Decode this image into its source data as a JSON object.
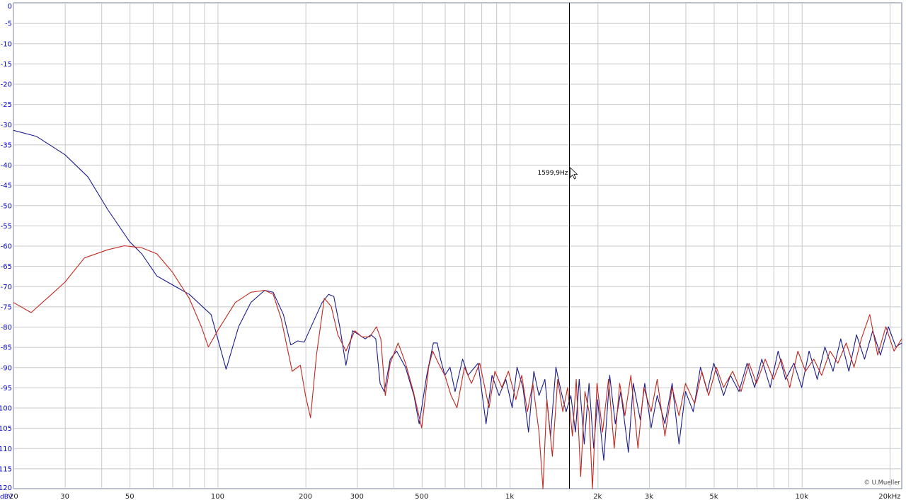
{
  "colors": {
    "background": "#ffffff",
    "grid": "#c8c8c8",
    "frame": "#6a7ea0",
    "ytick_text": "#0000cc",
    "series_blue": "#1c1c8c",
    "series_red": "#c0281e",
    "cursor": "#000000"
  },
  "cursor": {
    "label": "1599,9Hz",
    "freq_hz": 1599.9
  },
  "copyright": "© U.Mueller",
  "y_unit_label": "dBV",
  "chart_data": {
    "type": "line",
    "x_scale": "log",
    "xlim": [
      20,
      22000
    ],
    "ylim": [
      -120,
      0
    ],
    "grid": true,
    "ytick_values": [
      0,
      -5,
      -10,
      -15,
      -20,
      -25,
      -30,
      -35,
      -40,
      -45,
      -50,
      -55,
      -60,
      -65,
      -70,
      -75,
      -80,
      -85,
      -90,
      -95,
      -100,
      -105,
      -110,
      -115,
      -120
    ],
    "ytick_labels": [
      "0",
      "-5",
      "-10",
      "-15",
      "-20",
      "-25",
      "-30",
      "-35",
      "-40",
      "-45",
      "-50",
      "-55",
      "-60",
      "-65",
      "-70",
      "-75",
      "-80",
      "-85",
      "-90",
      "-95",
      "-100",
      "-105",
      "-110",
      "-115",
      "-120"
    ],
    "xtick_labels": [
      {
        "value": 20,
        "label": "20"
      },
      {
        "value": 30,
        "label": "30"
      },
      {
        "value": 50,
        "label": "50"
      },
      {
        "value": 100,
        "label": "100"
      },
      {
        "value": 200,
        "label": "200"
      },
      {
        "value": 300,
        "label": "300"
      },
      {
        "value": 500,
        "label": "500"
      },
      {
        "value": 1000,
        "label": "1k"
      },
      {
        "value": 2000,
        "label": "2k"
      },
      {
        "value": 3000,
        "label": "3k"
      },
      {
        "value": 5000,
        "label": "5k"
      },
      {
        "value": 10000,
        "label": "10k"
      },
      {
        "value": 20000,
        "label": "20kHz"
      }
    ],
    "series": [
      {
        "color": "#1c1c8c",
        "points": [
          [
            20,
            -31.5
          ],
          [
            24,
            -33
          ],
          [
            30,
            -37.5
          ],
          [
            36,
            -43
          ],
          [
            42,
            -51
          ],
          [
            50,
            -59
          ],
          [
            55,
            -62
          ],
          [
            62,
            -67.5
          ],
          [
            80,
            -72
          ],
          [
            95,
            -77
          ],
          [
            107,
            -90.5
          ],
          [
            118,
            -80
          ],
          [
            130,
            -74
          ],
          [
            145,
            -71
          ],
          [
            155,
            -71.5
          ],
          [
            168,
            -77
          ],
          [
            178,
            -84.5
          ],
          [
            188,
            -83.5
          ],
          [
            198,
            -83.8
          ],
          [
            212,
            -79
          ],
          [
            228,
            -74
          ],
          [
            240,
            -72
          ],
          [
            250,
            -72.5
          ],
          [
            262,
            -80
          ],
          [
            275,
            -89.5
          ],
          [
            290,
            -81
          ],
          [
            305,
            -82
          ],
          [
            320,
            -83
          ],
          [
            335,
            -82
          ],
          [
            348,
            -83
          ],
          [
            360,
            -94
          ],
          [
            372,
            -96
          ],
          [
            390,
            -88
          ],
          [
            410,
            -86
          ],
          [
            440,
            -90
          ],
          [
            470,
            -97
          ],
          [
            490,
            -104
          ],
          [
            520,
            -92
          ],
          [
            548,
            -84
          ],
          [
            565,
            -84
          ],
          [
            580,
            -88
          ],
          [
            600,
            -92
          ],
          [
            625,
            -90
          ],
          [
            650,
            -96
          ],
          [
            690,
            -88
          ],
          [
            720,
            -92
          ],
          [
            780,
            -89
          ],
          [
            830,
            -104
          ],
          [
            870,
            -92
          ],
          [
            920,
            -97
          ],
          [
            970,
            -93
          ],
          [
            1020,
            -100
          ],
          [
            1060,
            -90
          ],
          [
            1110,
            -95
          ],
          [
            1160,
            -106
          ],
          [
            1210,
            -91
          ],
          [
            1260,
            -97
          ],
          [
            1320,
            -93
          ],
          [
            1380,
            -107
          ],
          [
            1440,
            -90
          ],
          [
            1500,
            -96
          ],
          [
            1560,
            -101
          ],
          [
            1620,
            -97
          ],
          [
            1680,
            -106
          ],
          [
            1730,
            -93
          ],
          [
            1800,
            -109
          ],
          [
            1870,
            -94
          ],
          [
            1940,
            -110
          ],
          [
            2000,
            -98
          ],
          [
            2100,
            -113
          ],
          [
            2200,
            -92
          ],
          [
            2300,
            -104
          ],
          [
            2400,
            -96
          ],
          [
            2550,
            -111
          ],
          [
            2650,
            -94
          ],
          [
            2800,
            -103
          ],
          [
            2900,
            -94
          ],
          [
            3050,
            -105
          ],
          [
            3200,
            -97
          ],
          [
            3400,
            -104
          ],
          [
            3600,
            -94
          ],
          [
            3800,
            -109
          ],
          [
            4000,
            -96
          ],
          [
            4250,
            -101
          ],
          [
            4500,
            -90
          ],
          [
            4750,
            -96
          ],
          [
            5000,
            -89
          ],
          [
            5400,
            -97
          ],
          [
            5700,
            -92
          ],
          [
            6100,
            -96
          ],
          [
            6500,
            -89
          ],
          [
            6900,
            -95
          ],
          [
            7300,
            -88
          ],
          [
            7800,
            -95
          ],
          [
            8300,
            -86
          ],
          [
            8800,
            -93
          ],
          [
            9400,
            -89
          ],
          [
            10000,
            -95
          ],
          [
            10600,
            -86
          ],
          [
            11300,
            -93
          ],
          [
            12000,
            -85
          ],
          [
            12800,
            -91
          ],
          [
            13600,
            -83
          ],
          [
            14500,
            -91
          ],
          [
            15400,
            -82
          ],
          [
            16400,
            -88
          ],
          [
            17500,
            -81
          ],
          [
            18600,
            -87
          ],
          [
            19800,
            -80
          ],
          [
            21000,
            -85
          ],
          [
            22000,
            -84
          ]
        ]
      },
      {
        "color": "#c0281e",
        "points": [
          [
            20,
            -74
          ],
          [
            23,
            -76.5
          ],
          [
            27,
            -72
          ],
          [
            30,
            -69
          ],
          [
            35,
            -63
          ],
          [
            42,
            -61
          ],
          [
            48,
            -60
          ],
          [
            55,
            -60.5
          ],
          [
            62,
            -62
          ],
          [
            70,
            -66.5
          ],
          [
            80,
            -73
          ],
          [
            88,
            -80
          ],
          [
            93,
            -85
          ],
          [
            100,
            -81
          ],
          [
            115,
            -74
          ],
          [
            130,
            -71.5
          ],
          [
            145,
            -71
          ],
          [
            155,
            -72
          ],
          [
            165,
            -78
          ],
          [
            180,
            -91
          ],
          [
            192,
            -89.5
          ],
          [
            200,
            -97
          ],
          [
            208,
            -102.5
          ],
          [
            218,
            -87
          ],
          [
            232,
            -73
          ],
          [
            245,
            -75
          ],
          [
            258,
            -82
          ],
          [
            275,
            -86
          ],
          [
            295,
            -81
          ],
          [
            312,
            -82.5
          ],
          [
            332,
            -82.5
          ],
          [
            350,
            -80
          ],
          [
            362,
            -83
          ],
          [
            375,
            -97
          ],
          [
            390,
            -89
          ],
          [
            415,
            -84
          ],
          [
            440,
            -89
          ],
          [
            468,
            -96
          ],
          [
            500,
            -105
          ],
          [
            528,
            -90
          ],
          [
            545,
            -86
          ],
          [
            570,
            -89
          ],
          [
            600,
            -92
          ],
          [
            630,
            -97
          ],
          [
            660,
            -100
          ],
          [
            700,
            -90
          ],
          [
            740,
            -94
          ],
          [
            790,
            -89
          ],
          [
            850,
            -100
          ],
          [
            890,
            -91
          ],
          [
            940,
            -95
          ],
          [
            990,
            -91
          ],
          [
            1050,
            -98
          ],
          [
            1100,
            -92
          ],
          [
            1150,
            -101
          ],
          [
            1200,
            -94
          ],
          [
            1260,
            -106
          ],
          [
            1300,
            -120
          ],
          [
            1340,
            -98
          ],
          [
            1400,
            -112
          ],
          [
            1460,
            -93
          ],
          [
            1520,
            -101
          ],
          [
            1580,
            -95
          ],
          [
            1640,
            -107
          ],
          [
            1690,
            -93
          ],
          [
            1750,
            -117
          ],
          [
            1810,
            -96
          ],
          [
            1870,
            -101
          ],
          [
            1920,
            -120
          ],
          [
            1990,
            -94
          ],
          [
            2080,
            -106
          ],
          [
            2180,
            -93
          ],
          [
            2280,
            -110
          ],
          [
            2380,
            -94
          ],
          [
            2480,
            -102
          ],
          [
            2600,
            -92
          ],
          [
            2750,
            -110
          ],
          [
            2880,
            -95
          ],
          [
            3050,
            -101
          ],
          [
            3200,
            -93
          ],
          [
            3400,
            -107
          ],
          [
            3600,
            -95
          ],
          [
            3800,
            -102
          ],
          [
            4000,
            -94
          ],
          [
            4300,
            -99
          ],
          [
            4550,
            -91
          ],
          [
            4800,
            -97
          ],
          [
            5100,
            -90
          ],
          [
            5400,
            -95
          ],
          [
            5800,
            -91
          ],
          [
            6200,
            -96
          ],
          [
            6600,
            -89
          ],
          [
            7000,
            -94
          ],
          [
            7500,
            -88
          ],
          [
            8000,
            -93
          ],
          [
            8500,
            -88
          ],
          [
            9100,
            -95
          ],
          [
            9700,
            -86
          ],
          [
            10300,
            -91
          ],
          [
            11000,
            -88
          ],
          [
            11700,
            -92
          ],
          [
            12500,
            -86
          ],
          [
            13300,
            -89
          ],
          [
            14200,
            -84
          ],
          [
            15100,
            -90
          ],
          [
            16000,
            -83
          ],
          [
            17100,
            -77
          ],
          [
            18200,
            -87
          ],
          [
            19400,
            -80
          ],
          [
            20700,
            -86
          ],
          [
            22000,
            -83
          ]
        ]
      }
    ]
  }
}
